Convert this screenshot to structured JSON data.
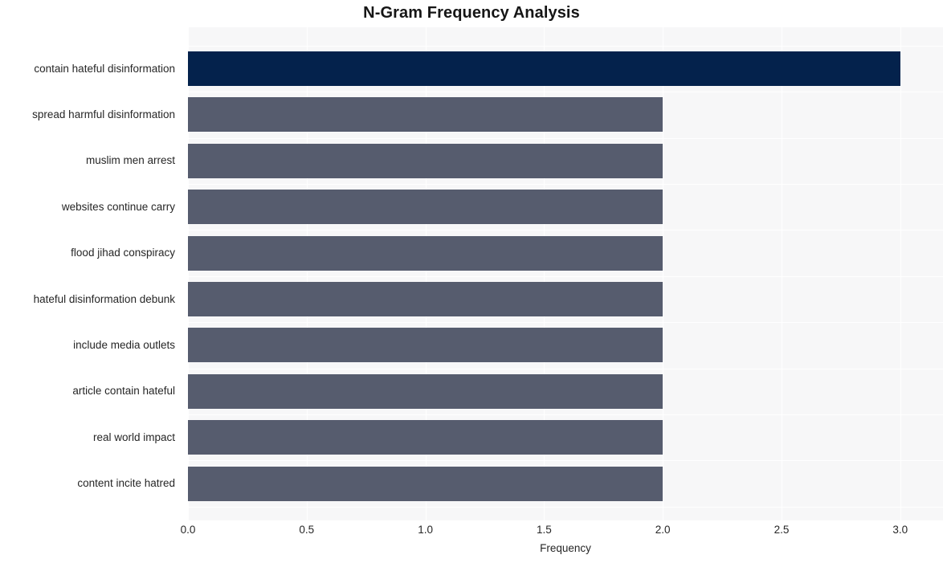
{
  "chart_data": {
    "type": "bar",
    "orientation": "horizontal",
    "title": "N-Gram Frequency Analysis",
    "xlabel": "Frequency",
    "ylabel": "",
    "categories": [
      "contain hateful disinformation",
      "spread harmful disinformation",
      "muslim men arrest",
      "websites continue carry",
      "flood jihad conspiracy",
      "hateful disinformation debunk",
      "include media outlets",
      "article contain hateful",
      "real world impact",
      "content incite hatred"
    ],
    "values": [
      3,
      2,
      2,
      2,
      2,
      2,
      2,
      2,
      2,
      2
    ],
    "xlim": [
      0.0,
      3.18
    ],
    "xticks": [
      0.0,
      0.5,
      1.0,
      1.5,
      2.0,
      2.5,
      3.0
    ],
    "xtick_labels": [
      "0.0",
      "0.5",
      "1.0",
      "1.5",
      "2.0",
      "2.5",
      "3.0"
    ],
    "grid": true,
    "legend": null,
    "colors": {
      "bar_default": "#565c6e",
      "bar_highlight": "#04224c",
      "plot_background": "#f7f7f8",
      "gridline": "#ffffff",
      "figure_background": "#ffffff",
      "text": "#262626"
    },
    "highlight_index": 0
  }
}
